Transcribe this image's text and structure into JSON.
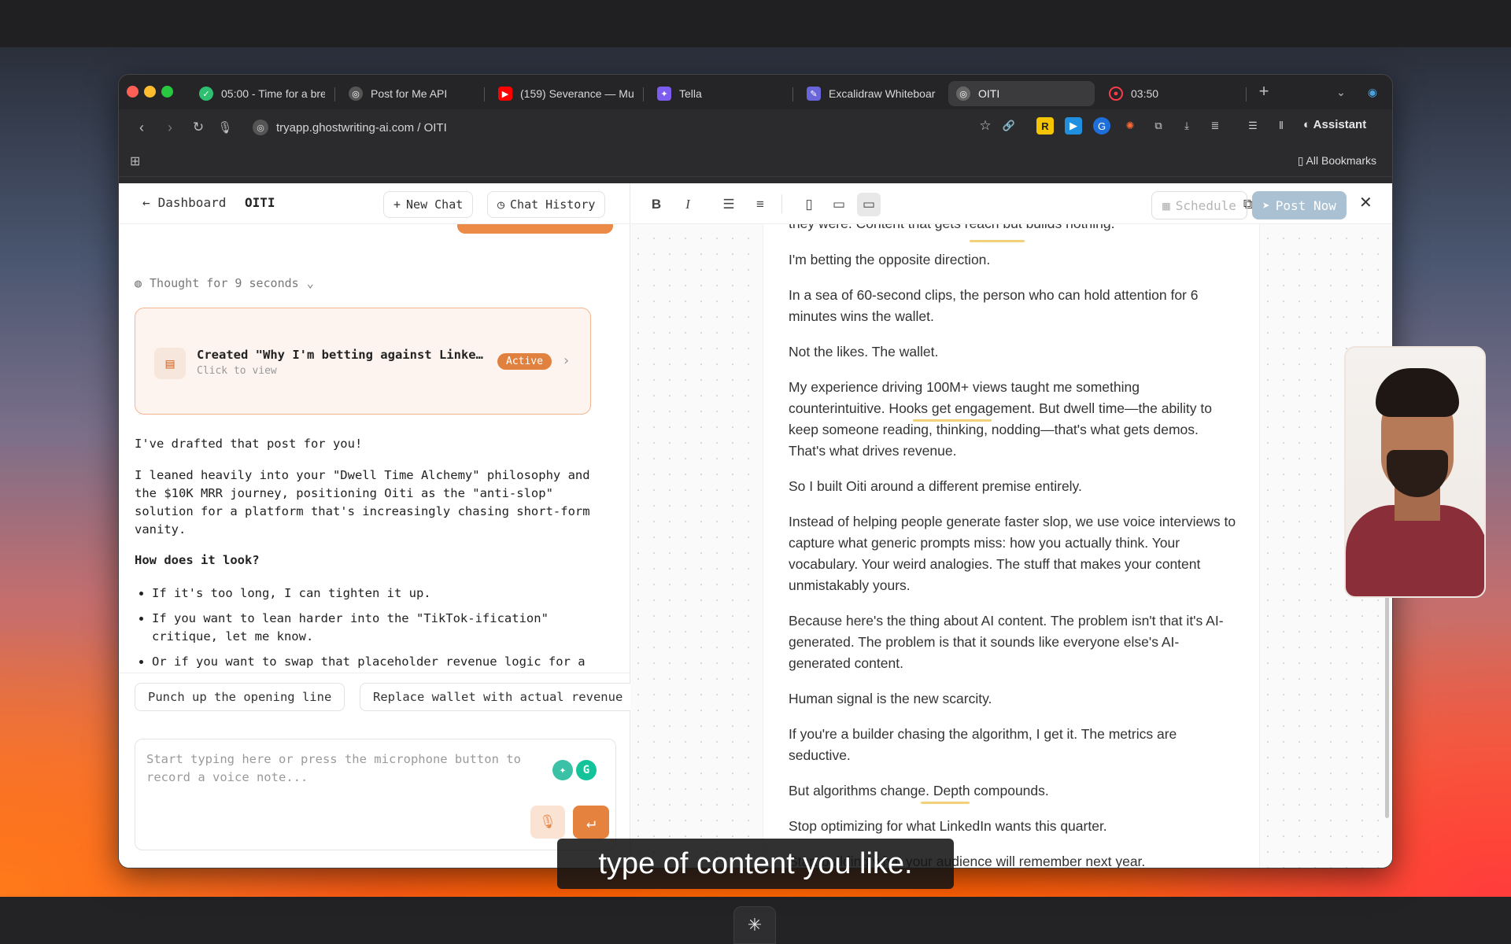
{
  "browser": {
    "tabs": [
      {
        "label": "05:00 - Time for a bre",
        "icon": "check-circle-icon"
      },
      {
        "label": "Post for Me API",
        "icon": "globe-icon"
      },
      {
        "label": "(159) Severance — Mu",
        "icon": "youtube-icon"
      },
      {
        "label": "Tella",
        "icon": "tella-icon"
      },
      {
        "label": "Excalidraw Whiteboar",
        "icon": "excalidraw-icon"
      },
      {
        "label": "OITI",
        "icon": "globe-icon"
      },
      {
        "label": "03:50",
        "icon": "record-icon"
      }
    ],
    "url": "tryapp.ghostwriting-ai.com / OITI",
    "assistant_label": "Assistant",
    "all_bookmarks": "All Bookmarks"
  },
  "chat": {
    "back_label": "Dashboard",
    "brand": "OITI",
    "new_chat": "New Chat",
    "chat_history": "Chat History",
    "thought": "Thought for 9 seconds",
    "card": {
      "title": "Created \"Why I'm betting against LinkedIn's video push\"",
      "subtitle": "Click to view",
      "badge": "Active"
    },
    "msg1": "I've drafted that post for you!",
    "msg2": "I leaned heavily into your \"Dwell Time Alchemy\" philosophy and the $10K MRR journey, positioning Oiti as the \"anti-slop\" solution for a platform that's increasingly chasing short-form vanity.",
    "question": "How does it look?",
    "bullets": [
      "If it's too long, I can tighten it up.",
      "If you want to lean harder into the \"TikTok-ification\" critique, let me know.",
      "Or if you want to swap that placeholder revenue logic for a specific demo story, we can do that too!"
    ],
    "suggestions": [
      "Punch up the opening line",
      "Replace wallet with actual revenue"
    ],
    "composer_placeholder": "Start typing here or press the microphone button to record a voice note..."
  },
  "editor": {
    "schedule": "Schedule",
    "post_now": "Post Now",
    "paragraphs": [
      "they were. Content that gets reach but builds nothing.",
      "I'm betting the opposite direction.",
      "In a sea of 60-second clips, the person who can hold attention for 6 minutes wins the wallet.",
      "Not the likes. The wallet.",
      "My experience driving 100M+ views taught me something counterintuitive. Hooks get engagement. But dwell time—the ability to keep someone reading, thinking, nodding—that's what gets demos. That's what drives revenue.",
      "So I built Oiti around a different premise entirely.",
      "Instead of helping people generate faster slop, we use voice interviews to capture what generic prompts miss: how you actually think. Your vocabulary. Your weird analogies. The stuff that makes your content unmistakably yours.",
      "Because here's the thing about AI content. The problem isn't that it's AI-generated. The problem is that it sounds like everyone else's AI-generated content.",
      "Human signal is the new scarcity.",
      "If you're a builder chasing the algorithm, I get it. The metrics are seductive.",
      "But algorithms change. Depth compounds.",
      "Stop optimizing for what LinkedIn wants this quarter.",
      "Start building what your audience will remember next year."
    ]
  },
  "caption": "type of content you like.",
  "colors": {
    "accent": "#e4823e",
    "post_now": "#a9c1d2"
  }
}
